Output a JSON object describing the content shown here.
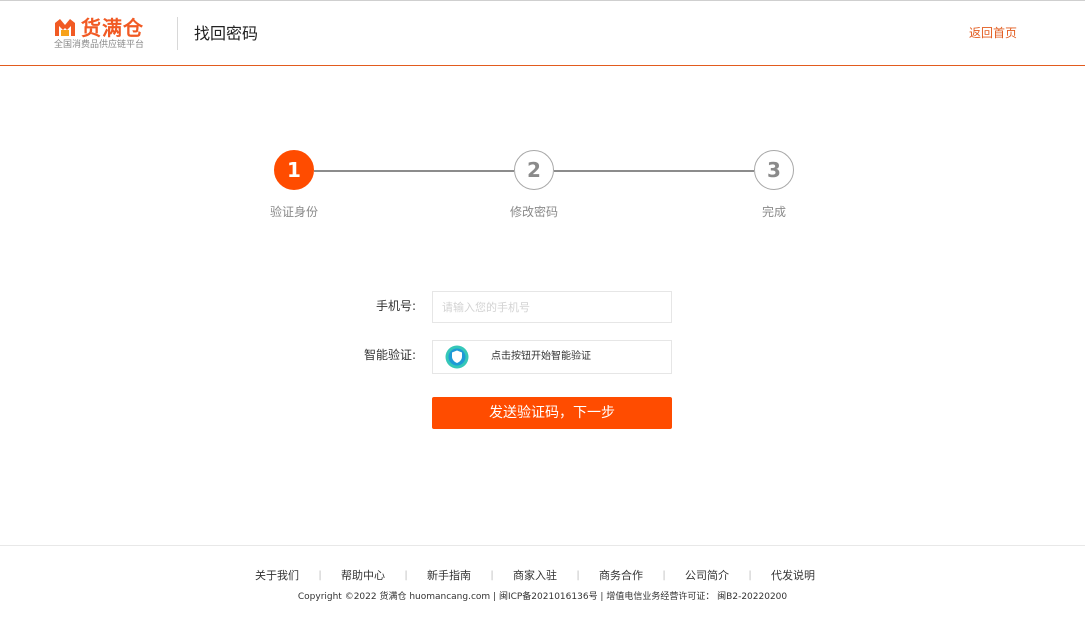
{
  "header": {
    "logo_name": "货满仓",
    "logo_slogan": "全国消费品供应链平台",
    "page_title": "找回密码",
    "home_link": "返回首页"
  },
  "steps": [
    {
      "number": "1",
      "label": "验证身份",
      "state": "active"
    },
    {
      "number": "2",
      "label": "修改密码",
      "state": "inactive"
    },
    {
      "number": "3",
      "label": "完成",
      "state": "inactive"
    }
  ],
  "form": {
    "phone_label": "手机号:",
    "phone_value": "",
    "phone_placeholder": "请输入您的手机号",
    "verify_label": "智能验证:",
    "verify_text": "点击按钮开始智能验证",
    "submit_label": "发送验证码，下一步"
  },
  "footer": {
    "links": [
      "关于我们",
      "帮助中心",
      "新手指南",
      "商家入驻",
      "商务合作",
      "公司简介",
      "代发说明"
    ],
    "copyright": "Copyright ©2022 货满仓 huomancang.com | 闽ICP备2021016136号 | 增值电信业务经营许可证： 闽B2-20220200"
  },
  "colors": {
    "brand": "#ff4c00",
    "header_border": "#e25b1e",
    "verify_icon": "#1bb8a9"
  },
  "icons": {
    "logo": "house-m-logo-icon",
    "verify": "shield-icon"
  }
}
